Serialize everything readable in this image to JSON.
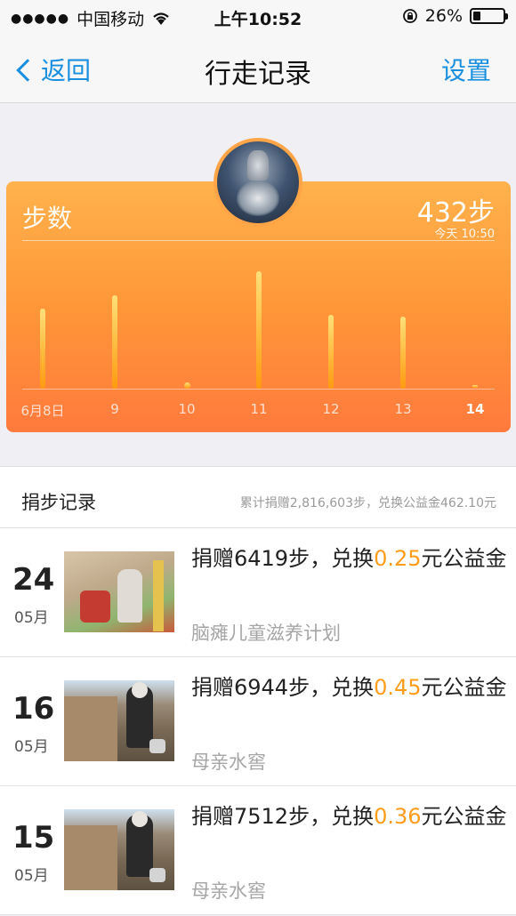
{
  "status_bar": {
    "carrier": "中国移动",
    "time": "上午10:52",
    "battery_text": "26%",
    "battery_level": 0.26
  },
  "nav": {
    "back_label": "返回",
    "title": "行走记录",
    "settings_label": "设置"
  },
  "card": {
    "label": "步数",
    "steps": "432步",
    "time": "今天 10:50"
  },
  "chart_data": {
    "type": "bar",
    "categories": [
      "6月8日",
      "9",
      "10",
      "11",
      "12",
      "13",
      "14"
    ],
    "values": [
      6419,
      7512,
      200,
      9400,
      5900,
      5800,
      432
    ],
    "ylim": [
      0,
      10000
    ],
    "highlight": "14",
    "bar_color": "#ffb000"
  },
  "section": {
    "label": "捐步记录",
    "summary": "累计捐赠2,816,603步，兑换公益金462.10元"
  },
  "records": [
    {
      "day": "24",
      "month": "05月",
      "prefix": "捐赠6419步，兑换",
      "amount": "0.25",
      "suffix": "元公益金",
      "project": "脑瘫儿童滋养计划"
    },
    {
      "day": "16",
      "month": "05月",
      "prefix": "捐赠6944步，兑换",
      "amount": "0.45",
      "suffix": "元公益金",
      "project": "母亲水窖"
    },
    {
      "day": "15",
      "month": "05月",
      "prefix": "捐赠7512步，兑换",
      "amount": "0.36",
      "suffix": "元公益金",
      "project": "母亲水窖"
    }
  ],
  "colors": {
    "accent_blue": "#1a8fe0",
    "amount_orange": "#ff9c1a",
    "card_top": "#ffb24d",
    "card_bottom": "#ff7a3d"
  }
}
